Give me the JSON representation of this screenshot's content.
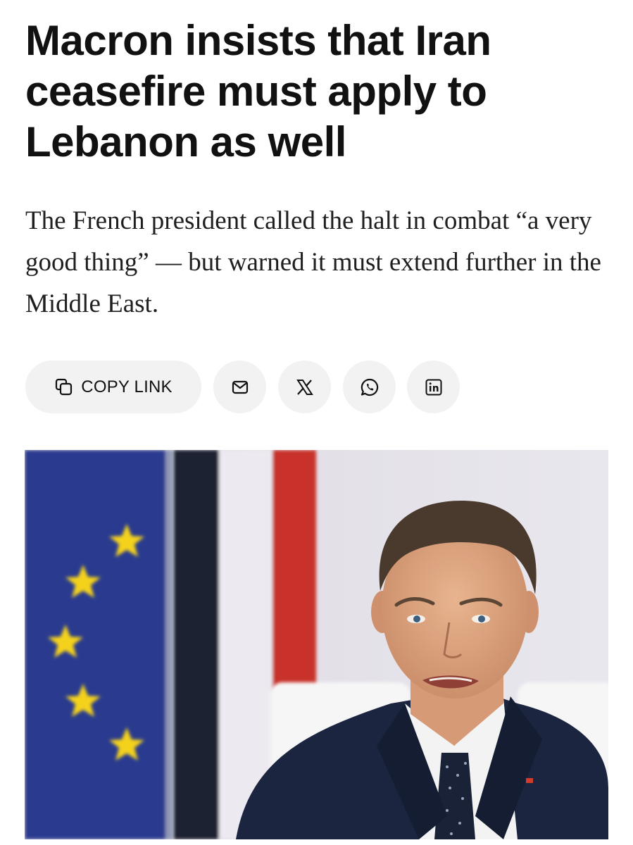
{
  "article": {
    "headline": "Macron insists that Iran ceasefire must apply to Lebanon as well",
    "dek": "The French president called the halt in combat “a very good thing” — but warned it must extend further in the Middle East."
  },
  "share": {
    "copy_link_label": "COPY LINK",
    "buttons": [
      {
        "name": "email",
        "icon": "mail-icon"
      },
      {
        "name": "x",
        "icon": "x-logo-icon"
      },
      {
        "name": "whatsapp",
        "icon": "whatsapp-icon"
      },
      {
        "name": "linkedin",
        "icon": "linkedin-icon"
      }
    ]
  },
  "photo": {
    "colors": {
      "eu_blue": "#2b3b8f",
      "star_yellow": "#f4d21b",
      "navy": "#1b2032",
      "red": "#c8302c",
      "suit": "#1c2540"
    }
  }
}
